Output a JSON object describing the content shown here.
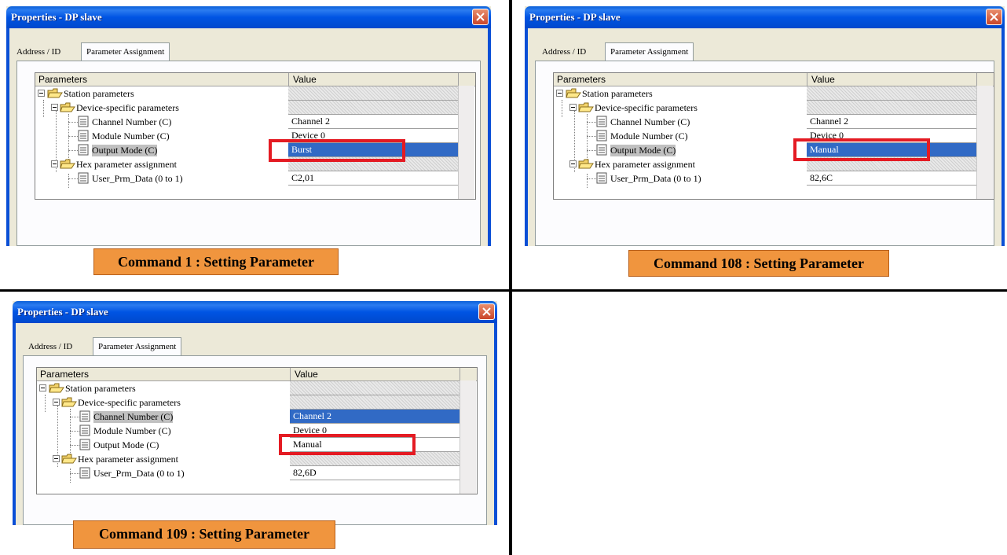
{
  "panels": [
    {
      "title": "Properties - DP slave",
      "tabs": [
        "Address / ID",
        "Parameter Assignment"
      ],
      "header": {
        "parameters": "Parameters",
        "value": "Value"
      },
      "rows": {
        "station": "Station parameters",
        "device": "Device-specific parameters",
        "channel": "Channel Number (C)",
        "module": "Module Number (C)",
        "output": "Output Mode (C)",
        "hex": "Hex parameter assignment",
        "user": "User_Prm_Data (0 to 1)"
      },
      "values": {
        "channel": "Channel 2",
        "module": "Device 0",
        "output": "Burst",
        "user": "C2,01"
      },
      "caption": "Command 1 : Setting Parameter"
    },
    {
      "title": "Properties - DP slave",
      "tabs": [
        "Address / ID",
        "Parameter Assignment"
      ],
      "header": {
        "parameters": "Parameters",
        "value": "Value"
      },
      "rows": {
        "station": "Station parameters",
        "device": "Device-specific parameters",
        "channel": "Channel Number (C)",
        "module": "Module Number (C)",
        "output": "Output Mode (C)",
        "hex": "Hex parameter assignment",
        "user": "User_Prm_Data (0 to 1)"
      },
      "values": {
        "channel": "Channel 2",
        "module": "Device 0",
        "output": "Manual",
        "user": "82,6C"
      },
      "caption": "Command 108 : Setting Parameter"
    },
    {
      "title": "Properties - DP slave",
      "tabs": [
        "Address / ID",
        "Parameter Assignment"
      ],
      "header": {
        "parameters": "Parameters",
        "value": "Value"
      },
      "rows": {
        "station": "Station parameters",
        "device": "Device-specific parameters",
        "channel": "Channel Number (C)",
        "module": "Module Number (C)",
        "output": "Output Mode (C)",
        "hex": "Hex parameter assignment",
        "user": "User_Prm_Data (0 to 1)"
      },
      "values": {
        "channel": "Channel 2",
        "module": "Device 0",
        "output": "Manual",
        "user": "82,6D"
      },
      "caption": "Command 109 : Setting Parameter"
    }
  ],
  "colors": {
    "highlight": "#e41b23",
    "caption_bg": "#f0953e",
    "selection": "#316ac5",
    "titlebar": "#0054e3"
  }
}
